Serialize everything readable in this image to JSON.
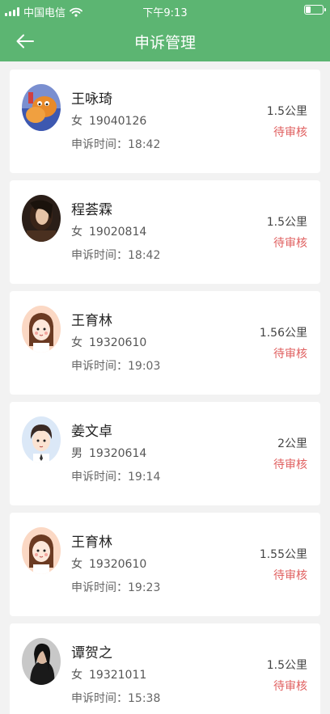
{
  "status_bar": {
    "carrier": "中国电信",
    "time": "下午9:13",
    "battery_level": 0.3
  },
  "navbar": {
    "title": "申诉管理",
    "back_icon": "arrow-left-icon"
  },
  "colors": {
    "header": "#5cb572",
    "status_text": "#e06060",
    "background": "#f2f2f2"
  },
  "records": [
    {
      "name": "王咏琦",
      "gender": "女",
      "id": "19040126",
      "time_label": "申诉时间：",
      "time": "18:42",
      "distance": "1.5公里",
      "status": "待审核",
      "avatar": "cartoon-cat-avatar"
    },
    {
      "name": "程荟霖",
      "gender": "女",
      "id": "19020814",
      "time_label": "申诉时间：",
      "time": "18:42",
      "distance": "1.5公里",
      "status": "待审核",
      "avatar": "photo-avatar"
    },
    {
      "name": "王育林",
      "gender": "女",
      "id": "19320610",
      "time_label": "申诉时间：",
      "time": "19:03",
      "distance": "1.56公里",
      "status": "待审核",
      "avatar": "cartoon-girl-avatar"
    },
    {
      "name": "姜文卓",
      "gender": "男",
      "id": "19320614",
      "time_label": "申诉时间：",
      "time": "19:14",
      "distance": "2公里",
      "status": "待审核",
      "avatar": "cartoon-boy-avatar"
    },
    {
      "name": "王育林",
      "gender": "女",
      "id": "19320610",
      "time_label": "申诉时间：",
      "time": "19:23",
      "distance": "1.55公里",
      "status": "待审核",
      "avatar": "cartoon-girl-avatar"
    },
    {
      "name": "谭贺之",
      "gender": "女",
      "id": "19321011",
      "time_label": "申诉时间：",
      "time": "15:38",
      "distance": "1.5公里",
      "status": "待审核",
      "avatar": "photo-avatar"
    }
  ]
}
